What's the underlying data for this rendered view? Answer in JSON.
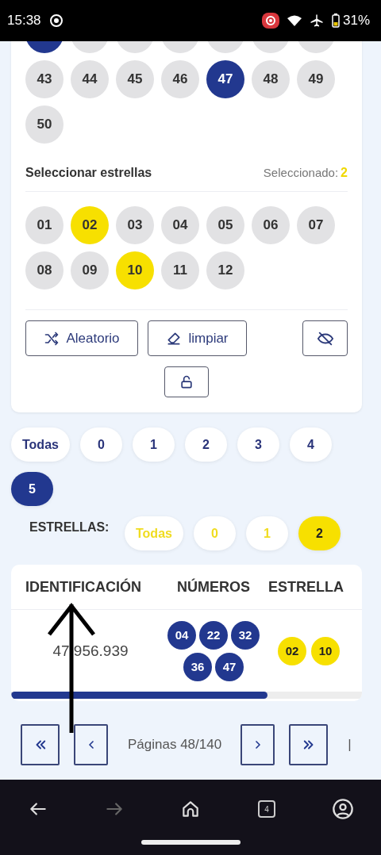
{
  "status_bar": {
    "time": "15:38",
    "battery": "31%"
  },
  "numbers_partial_row": [
    {
      "selected": true
    },
    {
      "selected": false
    },
    {
      "selected": false
    },
    {
      "selected": false
    },
    {
      "selected": false
    },
    {
      "selected": false
    },
    {
      "selected": false
    }
  ],
  "numbers": [
    {
      "label": "43",
      "selected": false
    },
    {
      "label": "44",
      "selected": false
    },
    {
      "label": "45",
      "selected": false
    },
    {
      "label": "46",
      "selected": false
    },
    {
      "label": "47",
      "selected": true
    },
    {
      "label": "48",
      "selected": false
    },
    {
      "label": "49",
      "selected": false
    },
    {
      "label": "50",
      "selected": false
    }
  ],
  "stars_section": {
    "title": "Seleccionar estrellas",
    "selected_label": "Seleccionado:",
    "selected_count": "2",
    "stars": [
      {
        "label": "01",
        "selected": false
      },
      {
        "label": "02",
        "selected": true
      },
      {
        "label": "03",
        "selected": false
      },
      {
        "label": "04",
        "selected": false
      },
      {
        "label": "05",
        "selected": false
      },
      {
        "label": "06",
        "selected": false
      },
      {
        "label": "07",
        "selected": false
      },
      {
        "label": "08",
        "selected": false
      },
      {
        "label": "09",
        "selected": false
      },
      {
        "label": "10",
        "selected": true
      },
      {
        "label": "11",
        "selected": false
      },
      {
        "label": "12",
        "selected": false
      }
    ]
  },
  "actions": [
    {
      "kind": "shuffle",
      "label": "Aleatorio"
    },
    {
      "kind": "eraser",
      "label": "limpiar"
    },
    {
      "kind": "hide"
    },
    {
      "kind": "lock"
    }
  ],
  "number_filters": [
    {
      "label": "Todas",
      "selected": false
    },
    {
      "label": "0",
      "selected": false
    },
    {
      "label": "1",
      "selected": false
    },
    {
      "label": "2",
      "selected": false
    },
    {
      "label": "3",
      "selected": false
    },
    {
      "label": "4",
      "selected": false
    },
    {
      "label": "5",
      "selected": true
    }
  ],
  "star_filter": {
    "label": "ESTRELLAS:",
    "options": [
      {
        "label": "Todas",
        "selected": false
      },
      {
        "label": "0",
        "selected": false
      },
      {
        "label": "1",
        "selected": false
      },
      {
        "label": "2",
        "selected": true
      }
    ]
  },
  "table": {
    "columns": [
      "IDENTIFICACIÓN",
      "NÚMEROS",
      "ESTRELLA"
    ],
    "rows": [
      {
        "id": "47.956.939",
        "numbers": [
          "04",
          "22",
          "32",
          "36",
          "47"
        ],
        "stars": [
          "02",
          "10"
        ]
      }
    ]
  },
  "pagination": {
    "label": "Páginas 48/140",
    "trailing": "|"
  },
  "bottom_nav": {
    "tab_count": "4",
    "forward_disabled": true
  }
}
